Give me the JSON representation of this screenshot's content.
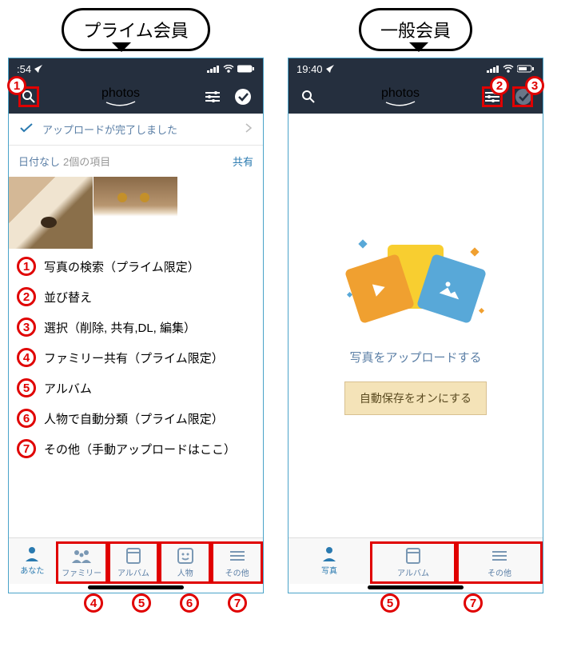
{
  "left": {
    "bubble": "プライム会員",
    "time": ":54",
    "header_title": "photos",
    "upload_done": "アップロードが完了しました",
    "date_none": "日付なし",
    "item_count": "2個の項目",
    "share": "共有",
    "legend": {
      "1": "写真の検索（プライム限定）",
      "2": "並び替え",
      "3": "選択（削除, 共有,DL, 編集）",
      "4": "ファミリー共有（プライム限定）",
      "5": "アルバム",
      "6": "人物で自動分類（プライム限定）",
      "7": "その他（手動アップロードはここ）"
    },
    "tabs": {
      "you": "あなた",
      "family": "ファミリー",
      "album": "アルバム",
      "people": "人物",
      "other": "その他"
    }
  },
  "right": {
    "bubble": "一般会員",
    "time": "19:40",
    "header_title": "photos",
    "empty_text": "写真をアップロードする",
    "auto_save_btn": "自動保存をオンにする",
    "tabs": {
      "photos": "写真",
      "album": "アルバム",
      "other": "その他"
    }
  },
  "markers": {
    "m1": "1",
    "m2": "2",
    "m3": "3",
    "m4": "4",
    "m5": "5",
    "m6": "6",
    "m7": "7"
  }
}
